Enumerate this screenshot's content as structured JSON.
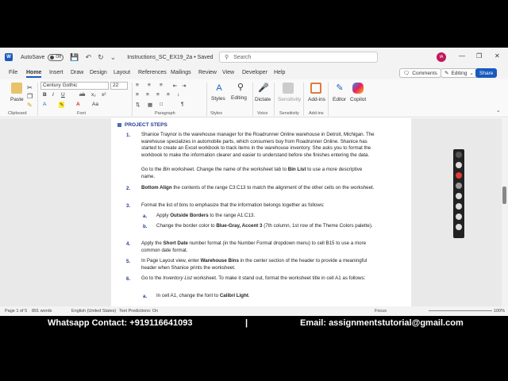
{
  "titlebar": {
    "logo": "W",
    "autosave_label": "AutoSave",
    "autosave_state": "Off",
    "doc_name": "Instructions_SC_EX19_2a • Saved",
    "search_placeholder": "Search",
    "avatar": "IA"
  },
  "menu": {
    "tabs": [
      "File",
      "Home",
      "Insert",
      "Draw",
      "Design",
      "Layout",
      "References",
      "Mailings",
      "Review",
      "View",
      "Developer",
      "Help"
    ],
    "active": "Home",
    "comments": "Comments",
    "editing": "Editing",
    "share": "Share"
  },
  "ribbon": {
    "paste": "Paste",
    "font_name": "Century Gothic",
    "font_size": "22",
    "styles": "Styles",
    "editing": "Editing",
    "dictate": "Dictate",
    "sensitivity": "Sensitivity",
    "addins": "Add-ins",
    "editor": "Editor",
    "copilot": "Copilot",
    "groups": [
      "Clipboard",
      "Font",
      "Paragraph",
      "Styles",
      "Voice",
      "Sensitivity",
      "Add-ins"
    ]
  },
  "document": {
    "heading": "PROJECT STEPS",
    "items": [
      {
        "num": "1.",
        "html": "Shanice Traynor is the warehouse manager for the Roadrunner Online warehouse in Detroit, Michigan. The warehouse specializes in automobile parts, which consumers buy from Roadrunner Online. Shanice has started to create an Excel workbook to track items in the warehouse inventory. She asks you to format the workbook to make the information clearer and easier to understand before she finishes entering the data."
      },
      {
        "num": "",
        "html": "Go to the <i>Bin</i> worksheet. Change the name of the worksheet tab to <b>Bin List</b> to use a more descriptive name."
      },
      {
        "num": "2.",
        "html": "<b>Bottom Align</b> the contents of the range C3:C13 to match the alignment of the other cells on the worksheet."
      },
      {
        "num": "3.",
        "html": "Format the list of bins to emphasize that the information belongs together as follows:"
      },
      {
        "num": "a.",
        "html": "Apply <b>Outside Borders</b> to the range A1:C13."
      },
      {
        "num": "b.",
        "html": "Change the border color to <b>Blue-Gray, Accent 3</b> (7th column, 1st row of the Theme Colors palette)."
      },
      {
        "num": "4.",
        "html": "Apply the <b>Short Date</b> number format (in the Number Format dropdown menu) to cell B15 to use a more common date format."
      },
      {
        "num": "5.",
        "html": "In Page Layout view, enter <b>Warehouse Bins</b> in the center section of the header to provide a meaningful header when Shanice prints the worksheet."
      },
      {
        "num": "6.",
        "html": "Go to the <i>Inventory List</i> worksheet. To make it stand out, format the worksheet title in cell A1 as follows:"
      },
      {
        "num": "a.",
        "html": "In cell A1, change the font to <b>Calibri Light</b>."
      }
    ]
  },
  "status": {
    "page": "Page 1 of 5",
    "words": "891 words",
    "language": "English (United States)",
    "predictions": "Text Predictions: On",
    "focus": "Focus",
    "zoom": "100%"
  },
  "banner": {
    "left": "Whatsapp Contact: +919116641093",
    "sep": "|",
    "right": "Email: assignmentstutorial@gmail.com"
  }
}
